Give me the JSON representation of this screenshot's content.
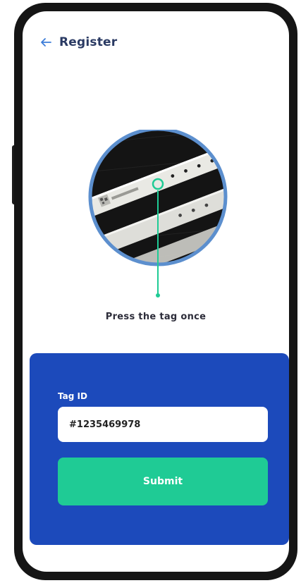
{
  "header": {
    "back_icon": "arrow-left-icon",
    "title": "Register"
  },
  "illustration": {
    "subject": "wristband-tag-photo",
    "pointer": "tag-indicator"
  },
  "instruction": {
    "text": "Press the tag once"
  },
  "form": {
    "tag_label": "Tag ID",
    "tag_value": "#1235469978",
    "submit_label": "Submit"
  },
  "colors": {
    "panel": "#1c4abb",
    "accent": "#1fcb95",
    "header_text": "#2a3a63",
    "back_arrow": "#3d7dd8",
    "ring": "#5c8fce"
  }
}
